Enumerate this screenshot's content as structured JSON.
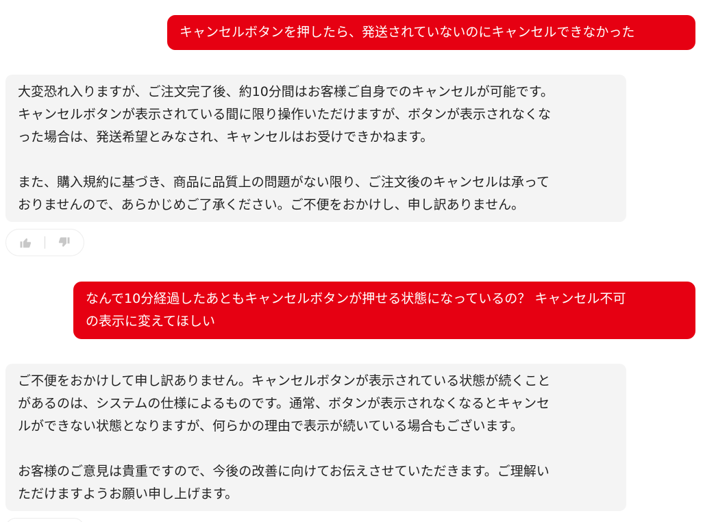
{
  "messages": [
    {
      "role": "user",
      "text": "キャンセルボタンを押したら、発送されていないのにキャンセルできなかった"
    },
    {
      "role": "assistant",
      "text": "大変恐れ入りますが、ご注文完了後、約10分間はお客様ご自身でのキャンセルが可能です。\nキャンセルボタンが表示されている間に限り操作いただけますが、ボタンが表示されなくな\nった場合は、発送希望とみなされ、キャンセルはお受けできかねます。\n\nまた、購入規約に基づき、商品に品質上の問題がない限り、ご注文後のキャンセルは承って\nおりませんので、あらかじめご了承ください。ご不便をおかけし、申し訳ありません。"
    },
    {
      "role": "user",
      "text": "なんで10分経過したあともキャンセルボタンが押せる状態になっているの？ キャンセル不可\nの表示に変えてほしい"
    },
    {
      "role": "assistant",
      "text": "ご不便をおかけして申し訳ありません。キャンセルボタンが表示されている状態が続くこと\nがあるのは、システムの仕様によるものです。通常、ボタンが表示されなくなるとキャンセ\nルができない状態となりますが、何らかの理由で表示が続いている場合もございます。\n\nお客様のご意見は貴重ですので、今後の改善に向けてお伝えさせていただきます。ご理解い\nただけますようお願い申し上げます。"
    }
  ],
  "feedback": {
    "like_icon": "thumbs-up-icon",
    "dislike_icon": "thumbs-down-icon"
  },
  "colors": {
    "user_bubble": "#e60012",
    "assistant_bubble": "#f4f4f4",
    "icon": "#c8c8c8"
  }
}
